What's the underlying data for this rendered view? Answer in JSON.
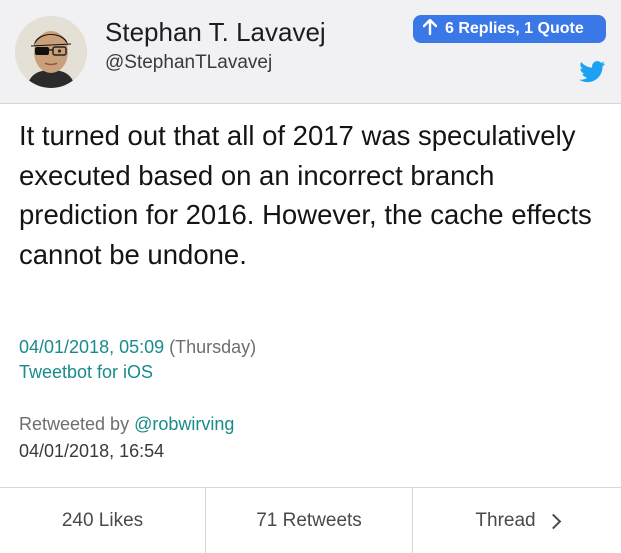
{
  "header": {
    "display_name": "Stephan T. Lavavej",
    "handle": "@StephanTLavavej",
    "replies_badge": "6 Replies, 1 Quote",
    "avatar_icon": "user-avatar",
    "badge_arrow_icon": "arrow-up-icon",
    "brand_icon": "twitter-bird-icon",
    "colors": {
      "badge": "#3b78e7",
      "twitter_blue": "#1da1f2"
    }
  },
  "tweet": {
    "text": "It turned out that all of 2017 was speculatively executed based on an incorrect branch prediction for 2016. However, the cache effects cannot be undone."
  },
  "meta": {
    "timestamp": "04/01/2018, 05:09",
    "weekday": "(Thursday)",
    "client": "Tweetbot for iOS",
    "retweeted_by_label": "Retweeted by",
    "retweeted_by_handle": "@robwirving",
    "retweet_timestamp": "04/01/2018, 16:54",
    "colors": {
      "link": "#188b8a"
    }
  },
  "footer": {
    "likes": "240 Likes",
    "retweets": "71 Retweets",
    "thread": "Thread",
    "thread_icon": "chevron-right-icon"
  }
}
